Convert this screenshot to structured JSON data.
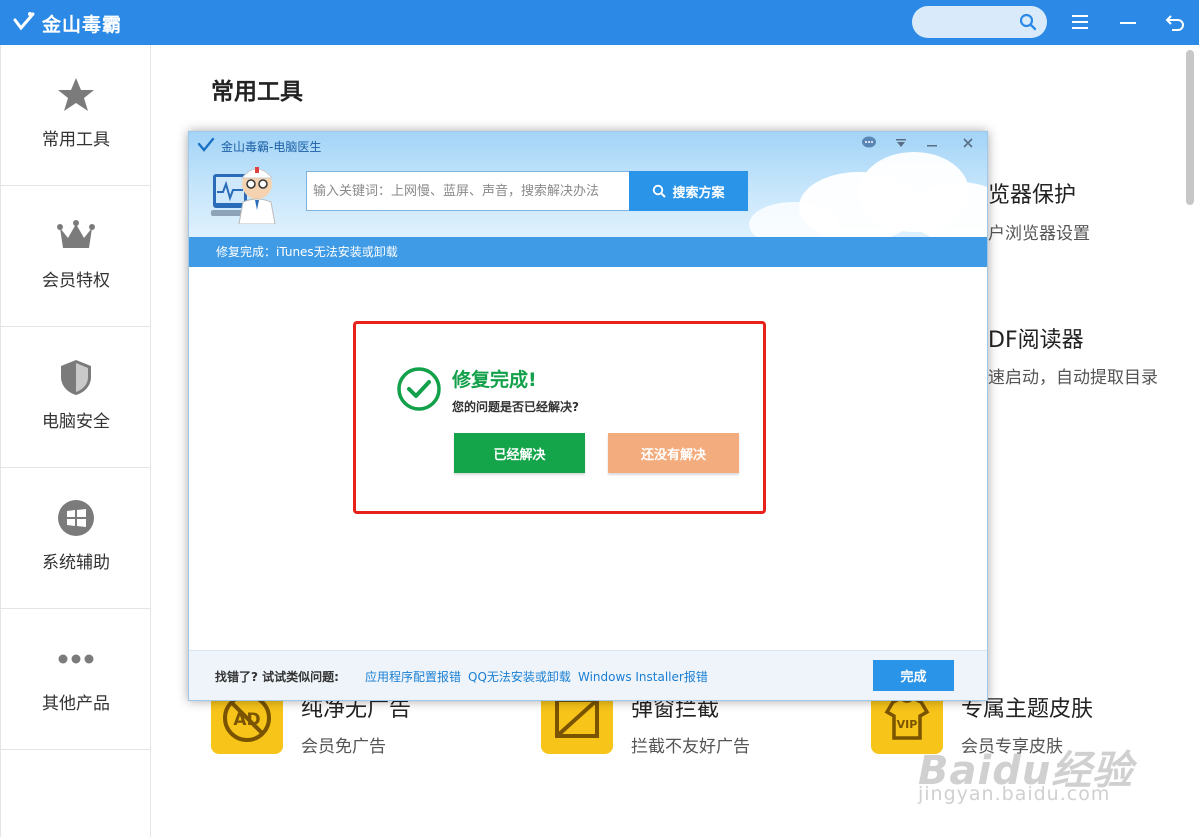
{
  "app": {
    "title": "金山毒霸",
    "brand_color": "#2c8ae6",
    "icons": [
      "search-icon",
      "menu-icon",
      "minimize-icon",
      "back-icon"
    ]
  },
  "sidebar": {
    "items": [
      {
        "label": "常用工具",
        "icon": "star-icon"
      },
      {
        "label": "会员特权",
        "icon": "crown-icon"
      },
      {
        "label": "电脑安全",
        "icon": "shield-icon"
      },
      {
        "label": "系统辅助",
        "icon": "windows-icon"
      },
      {
        "label": "其他产品",
        "icon": "more-dots-icon"
      }
    ]
  },
  "main": {
    "title": "常用工具",
    "tools": [
      {
        "title": "览器保护",
        "desc": "户浏览器设置"
      },
      {
        "title": "DF阅读器",
        "desc": "速启动，自动提取目录"
      },
      {
        "title": "纯净无广告",
        "desc": "会员免广告",
        "icon": "ad-block-icon"
      },
      {
        "title": "弹窗拦截",
        "desc": "拦截不友好广告",
        "icon": "popup-block-icon"
      },
      {
        "title": "专属主题皮肤",
        "desc": "会员专享皮肤",
        "icon": "vip-shirt-icon"
      }
    ]
  },
  "dialog": {
    "title": "金山毒霸-电脑医生",
    "search_placeholder": "输入关键词：上网慢、蓝屏、声音，搜索解决办法",
    "search_button": "搜索方案",
    "status": "修复完成：iTunes无法安装或卸载",
    "result_title": "修复完成!",
    "result_question": "您的问题是否已经解决?",
    "solved_button": "已经解决",
    "unsolved_button": "还没有解决",
    "footer_label": "找错了? 试试类似问题:",
    "footer_links": [
      "应用程序配置报错",
      "QQ无法安装或卸载",
      "Windows Installer报错"
    ],
    "done_button": "完成",
    "colors": {
      "success": "#12a04a",
      "highlight_border": "#e6221b",
      "secondary": "#f2ac7e"
    }
  },
  "watermark": {
    "brand": "Baidu经验",
    "url": "jingyan.baidu.com"
  }
}
